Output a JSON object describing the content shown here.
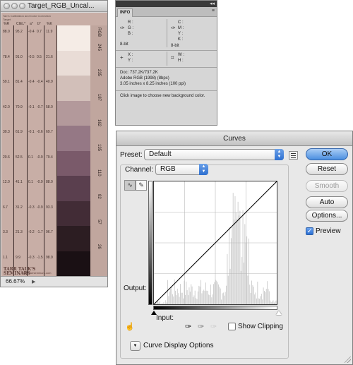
{
  "document": {
    "title": "Target_RGB_Uncal...",
    "target_title": "Tarr's Calibration and Color Correction Target",
    "columns": [
      "%R",
      "CIEL*",
      "a*",
      "b*",
      "%K"
    ],
    "rows": [
      [
        "88.0",
        "95.2",
        "-0.4",
        "0.7",
        "11.9"
      ],
      [
        "78.4",
        "91.0",
        "-0.5",
        "0.5",
        "21.6"
      ],
      [
        "59.1",
        "81.4",
        "-0.4",
        "-0.4",
        "40.9"
      ],
      [
        "42.0",
        "70.9",
        "-0.1",
        "-0.7",
        "58.0"
      ],
      [
        "30.3",
        "61.9",
        "-0.1",
        "-0.6",
        "69.7"
      ],
      [
        "20.6",
        "52.5",
        "0.1",
        "-0.9",
        "79.4"
      ],
      [
        "12.0",
        "41.1",
        "0.1",
        "-0.9",
        "88.0"
      ],
      [
        "6.7",
        "31.2",
        "-0.3",
        "-0.9",
        "93.3"
      ],
      [
        "3.3",
        "21.3",
        "-0.2",
        "-1.7",
        "96.7"
      ],
      [
        "1.1",
        "9.9",
        "-0.3",
        "-1.5",
        "98.9"
      ]
    ],
    "rgb_header": "RGB",
    "rgb_values": [
      "245",
      "235",
      "187",
      "162",
      "135",
      "110",
      "82",
      "57",
      "26"
    ],
    "swatch_colors": [
      "#f5ece6",
      "#e9dcd6",
      "#d2bfb9",
      "#b3999b",
      "#957885",
      "#7a5a6a",
      "#5a3f4e",
      "#422c36",
      "#2c1d22",
      "#1a1014"
    ],
    "logo_lines": [
      "TARR TALK'S",
      "SEMINARS"
    ],
    "logo_url": "www.tarrseminars.com",
    "zoom": "66.67%"
  },
  "info": {
    "tab": "INFO",
    "rgb_labels": [
      "R :",
      "G :",
      "B :"
    ],
    "cmyk_labels": [
      "C :",
      "M :",
      "Y :",
      "K :"
    ],
    "bit_left": "8-bit",
    "bit_right": "8-bit",
    "xy_labels": [
      "X :",
      "Y :"
    ],
    "wh_labels": [
      "W :",
      "H :"
    ],
    "doc_lines": [
      "Doc: 737.2K/737.2K",
      "Adobe RGB (1998) (8bpc)",
      "3.05 inches x 8.25 inches (100 ppi)"
    ],
    "hint": "Click image to choose new background color."
  },
  "curves": {
    "title": "Curves",
    "preset_label": "Preset:",
    "preset_value": "Default",
    "channel_label": "Channel:",
    "channel_value": "RGB",
    "output_label": "Output:",
    "input_label": "Input:",
    "show_clipping": "Show Clipping",
    "display_options": "Curve Display Options",
    "buttons": {
      "ok": "OK",
      "reset": "Reset",
      "smooth": "Smooth",
      "auto": "Auto",
      "options": "Options..."
    },
    "preview": "Preview",
    "histogram_color": "#cfcfcf"
  }
}
